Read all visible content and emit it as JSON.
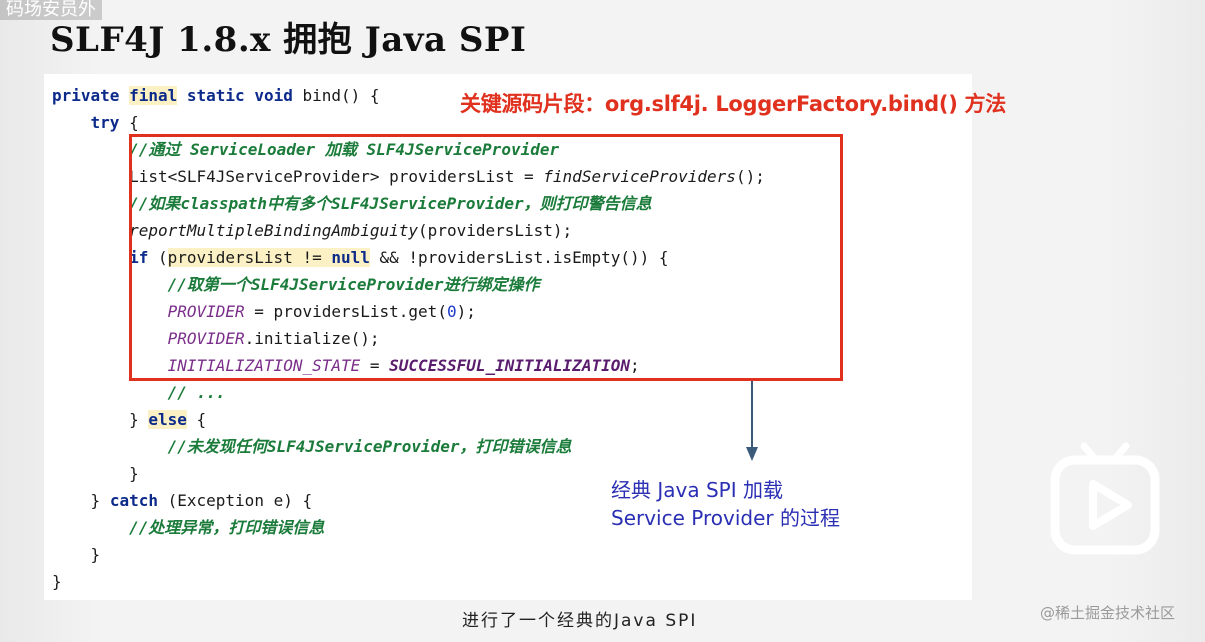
{
  "watermark_top": "码场安员外",
  "title": "SLF4J 1.8.x 拥抱 Java SPI",
  "key_note": "关键源码片段：org.slf4j. LoggerFactory.bind() 方法",
  "annotation": {
    "line1": "经典 Java SPI 加载",
    "line2": "Service Provider 的过程"
  },
  "subtitle": "进行了一个经典的Java SPI",
  "site_watermark": "@稀土掘金技术社区",
  "code": {
    "kw_private": "private",
    "kw_final": "final",
    "kw_static": "static",
    "kw_void": "void",
    "method_sig": " bind() {",
    "kw_try": "try",
    "brace_open": " {",
    "comment_serviceloader": "//通过 ServiceLoader 加载 SLF4JServiceProvider",
    "list_decl": "List<SLF4JServiceProvider> providersList = ",
    "find_call": "findServiceProviders",
    "call_end": "();",
    "comment_multiple": "//如果classpath中有多个SLF4JServiceProvider，则打印警告信息",
    "report_call": "reportMultipleBindingAmbiguity",
    "report_args": "(providersList);",
    "kw_if": "if",
    "if_open": " (",
    "providers_list": "providersList",
    "not_equal": " != ",
    "kw_null": "null",
    "if_rest": " && !providersList.isEmpty()) {",
    "comment_first": "//取第一个SLF4JServiceProvider进行绑定操作",
    "provider": "PROVIDER",
    "provider_get": " = providersList.get(",
    "zero": "0",
    "provider_get_end": ");",
    "provider_init": ".initialize();",
    "init_state": "INITIALIZATION_STATE",
    "assign": " = ",
    "success_init": "SUCCESSFUL_INITIALIZATION",
    "semicolon": ";",
    "comment_ellipsis": "// ...",
    "close_brace": "}",
    "kw_else": "else",
    "comment_not_found": "//未发现任何SLF4JServiceProvider，打印错误信息",
    "kw_catch": "catch",
    "catch_args": " (Exception e) {",
    "comment_exception": "//处理异常，打印错误信息"
  },
  "colors": {
    "highlight_red": "#e0301e",
    "annotation_blue": "#2a2fb3",
    "keyword_navy": "#0b2a8a",
    "comment_green": "#1b7b3a",
    "static_purple": "#7a2e8a"
  },
  "icons": {
    "play_logo": "bilibili-play-icon",
    "arrow": "arrow-down-icon"
  }
}
